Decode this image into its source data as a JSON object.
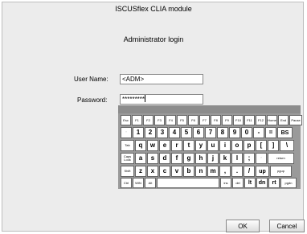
{
  "window": {
    "title": "ISCUSflex CLIA module"
  },
  "dialog": {
    "heading": "Administrator login",
    "user_name_label": "User Name:",
    "user_name_value": "<ADM>",
    "password_label": "Password:",
    "password_value": "*********"
  },
  "keyboard": {
    "rows": [
      [
        "Esc",
        "F1",
        "F2",
        "F3",
        "F4",
        "F5",
        "F6",
        "F7",
        "F8",
        "F9",
        "F10",
        "F11",
        "F12",
        "Home",
        "End",
        "Pause"
      ],
      [
        "'",
        "1",
        "2",
        "3",
        "4",
        "5",
        "6",
        "7",
        "8",
        "9",
        "0",
        "-",
        "=",
        "BS"
      ],
      [
        "Tab",
        "q",
        "w",
        "e",
        "r",
        "t",
        "y",
        "u",
        "i",
        "o",
        "p",
        "[",
        "]",
        "\\"
      ],
      [
        "Caps Lock",
        "a",
        "s",
        "d",
        "f",
        "g",
        "h",
        "j",
        "k",
        "l",
        ";",
        "'",
        "return"
      ],
      [
        "Shift",
        "z",
        "x",
        "c",
        "v",
        "b",
        "n",
        "m",
        ",",
        ".",
        "/",
        "up",
        "pgup"
      ],
      [
        "Ctrl",
        "WIN",
        "Alt",
        "",
        "ins",
        "del",
        "lt",
        "dn",
        "rt",
        "pgdn"
      ]
    ]
  },
  "buttons": {
    "ok": "OK",
    "cancel": "Cancel"
  }
}
